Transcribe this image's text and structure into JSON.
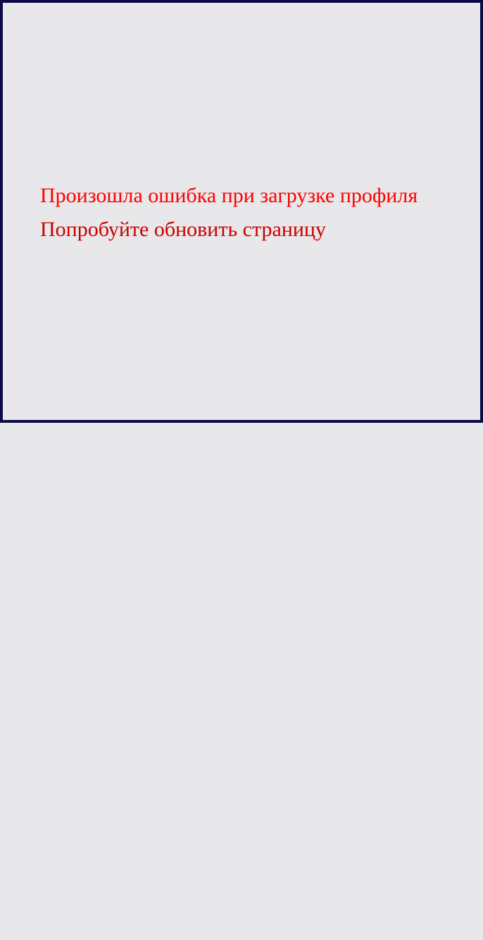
{
  "error": {
    "title": "Произошла ошибка при загрузке профиля",
    "hint": "Попробуйте обновить страницу"
  },
  "colors": {
    "background": "#e8e7e9",
    "border": "#0c0a45",
    "error_title": "#ff0000",
    "error_hint": "#cc0000"
  }
}
